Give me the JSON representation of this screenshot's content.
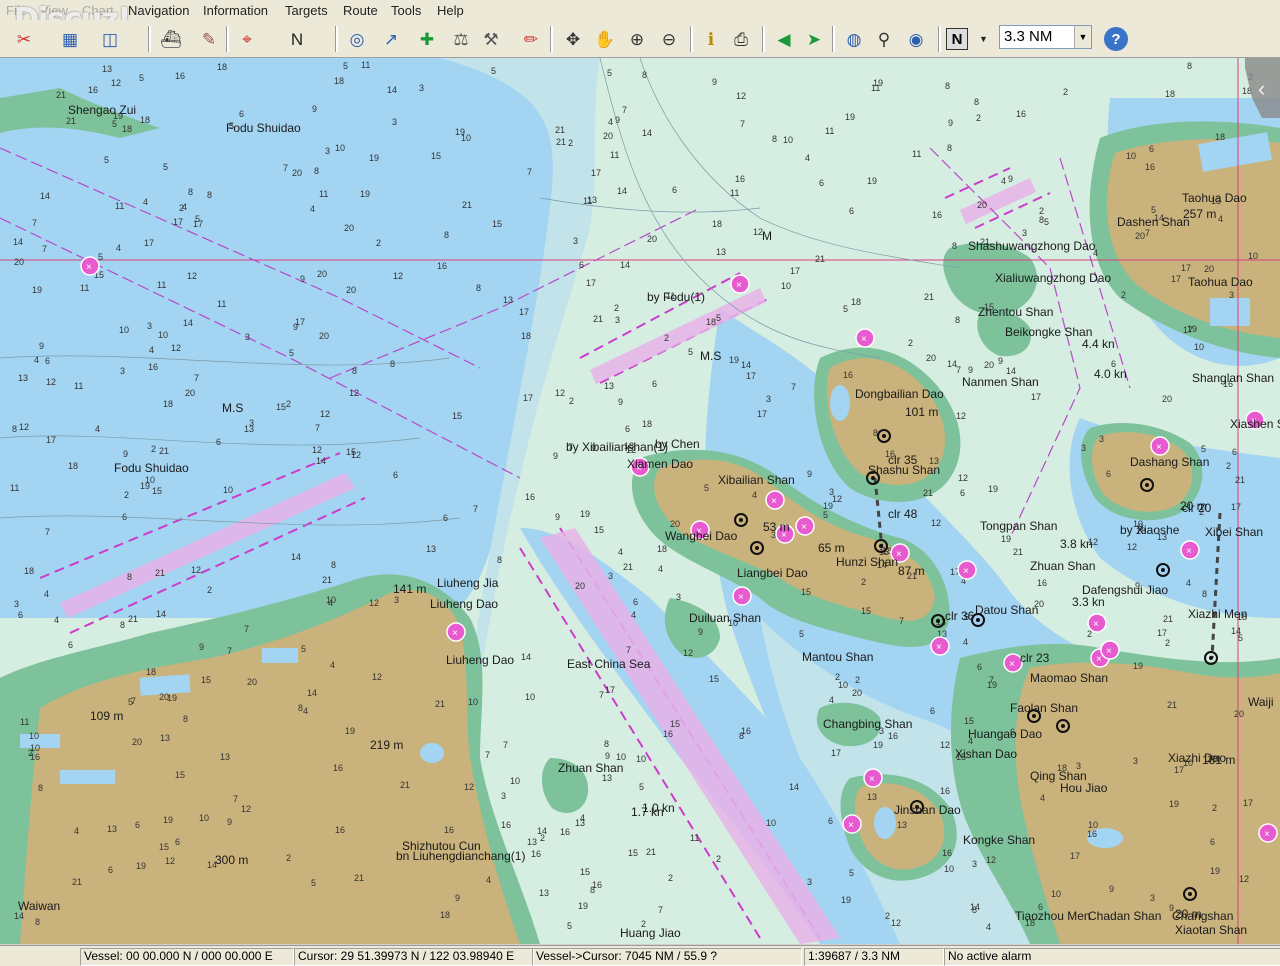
{
  "app": {
    "logo_text": "Discuz!"
  },
  "menu": [
    {
      "label": "File"
    },
    {
      "label": "View"
    },
    {
      "label": "Chart"
    },
    {
      "label": "Navigation"
    },
    {
      "label": "Information"
    },
    {
      "label": "Targets"
    },
    {
      "label": "Route"
    },
    {
      "label": "Tools"
    },
    {
      "label": "Help"
    }
  ],
  "toolbar": {
    "buttons": [
      {
        "icon": "ship-wrench-icon",
        "glyph": "✂"
      },
      {
        "icon": "chart-open-icon",
        "glyph": "▦"
      },
      {
        "icon": "layers-icon",
        "glyph": "◫"
      },
      {
        "icon": "vessel-icon",
        "glyph": "⛴"
      },
      {
        "icon": "chart-edit-icon",
        "glyph": "✎"
      },
      {
        "icon": "track-icon",
        "glyph": "⌖"
      },
      {
        "icon": "north-arrow-icon",
        "glyph": "N"
      },
      {
        "icon": "target-circle-icon",
        "glyph": "◎"
      },
      {
        "icon": "direction-arrow-icon",
        "glyph": "↗"
      },
      {
        "icon": "add-waypoint-icon",
        "glyph": "✚"
      },
      {
        "icon": "measure-icon",
        "glyph": "⚖"
      },
      {
        "icon": "ebl-icon",
        "glyph": "⚒"
      },
      {
        "icon": "pencil-icon",
        "glyph": "✏"
      },
      {
        "icon": "pan-icon",
        "glyph": "✥"
      },
      {
        "icon": "hand-icon",
        "glyph": "✋"
      },
      {
        "icon": "zoom-in-icon",
        "glyph": "⊕"
      },
      {
        "icon": "zoom-out-icon",
        "glyph": "⊖"
      },
      {
        "icon": "info-icon",
        "glyph": "ℹ"
      },
      {
        "icon": "print-icon",
        "glyph": "⎙"
      },
      {
        "icon": "green-arrow-icon",
        "glyph": "◀"
      },
      {
        "icon": "cursor-arrow-icon",
        "glyph": "➤"
      },
      {
        "icon": "globe-icon",
        "glyph": "◍"
      },
      {
        "icon": "antenna-icon",
        "glyph": "⚲"
      },
      {
        "icon": "world-icon",
        "glyph": "◉"
      }
    ],
    "orientation": "N",
    "zoom_value": "3.3 NM",
    "help_glyph": "?"
  },
  "colors": {
    "deep_water": "#a3d4f2",
    "shallow_water": "#c2e3ea",
    "offshore": "#d6ede1",
    "intertidal": "#7dc29a",
    "land": "#c9b27c",
    "route_magenta": "#cc3ccc",
    "alarm_magenta": "#e85ad0"
  },
  "chart": {
    "labels": [
      "Shengao Zui",
      "Fodu Shuidao",
      "Fodu Shuidao",
      "Liuheng Jia",
      "Liuheng Dao",
      "Liuheng Dao",
      "Shizhutou Cun",
      "bn Liuhengdianchang(1)",
      "Waiwan",
      "East China Sea",
      "Zhuan Shan",
      "Huang Jiao",
      "by Fodu(1)",
      "M.S",
      "by Xibailianshan(1)",
      "by Chen",
      "Xiamen Dao",
      "Xibailian Shan",
      "Wangbei Dao",
      "Liangbei Dao",
      "Duiluan Shan",
      "Mantou Shan",
      "Changbing Shan",
      "Jinshan Dao",
      "Dongbailian Dao",
      "Nanmen Shan",
      "Shashu Shan",
      "Hunzi Shan",
      "Tongpan Shan",
      "Zhuan Shan",
      "Datou Shan",
      "Shashuwangzhong Dao",
      "Xialiuwangzhong Dao",
      "Zhentou Shan",
      "Beikongke Shan",
      "Dashen Shan",
      "Taohua Dao",
      "Taohua Dao",
      "Shanglan Shan",
      "Xiashen Shan",
      "Dashang Shan",
      "by Xiaoshe",
      "Dafengshui Jiao",
      "Xiazhi Men",
      "Xiazhi Dao",
      "Maomao Shan",
      "Faolan Shan",
      "Huangao Dao",
      "Xishan Dao",
      "Qing Shan",
      "Hou Jiao",
      "Kongke Shan",
      "Tiaozhou Men",
      "Changshan",
      "Chadan Shan",
      "Xiaotan Shan",
      "Waiji",
      "Xibei Shan",
      "M.S"
    ],
    "heights": [
      "141 m",
      "109 m",
      "219 m",
      "300 m",
      "101 m",
      "53 m",
      "65 m",
      "87 m",
      "257 m",
      "20 m",
      "20 m",
      "181 m"
    ],
    "notes": [
      "clr 48",
      "clr 35",
      "clr 23",
      "clr 20",
      "clr 36",
      "4.4 kn",
      "4.0 kn",
      "3.8 kn",
      "3.3 kn",
      "1.7 kn",
      "1.0 kn",
      "M"
    ]
  },
  "status": {
    "vessel": "Vessel: 00 00.000 N / 000 00.000 E",
    "cursor": "Cursor: 29 51.39973 N / 122 03.98940 E",
    "vessel_cursor": "Vessel->Cursor: 7045 NM / 55.9 ?",
    "scale": "1:39687 / 3.3 NM",
    "alarm": "No active alarm"
  }
}
